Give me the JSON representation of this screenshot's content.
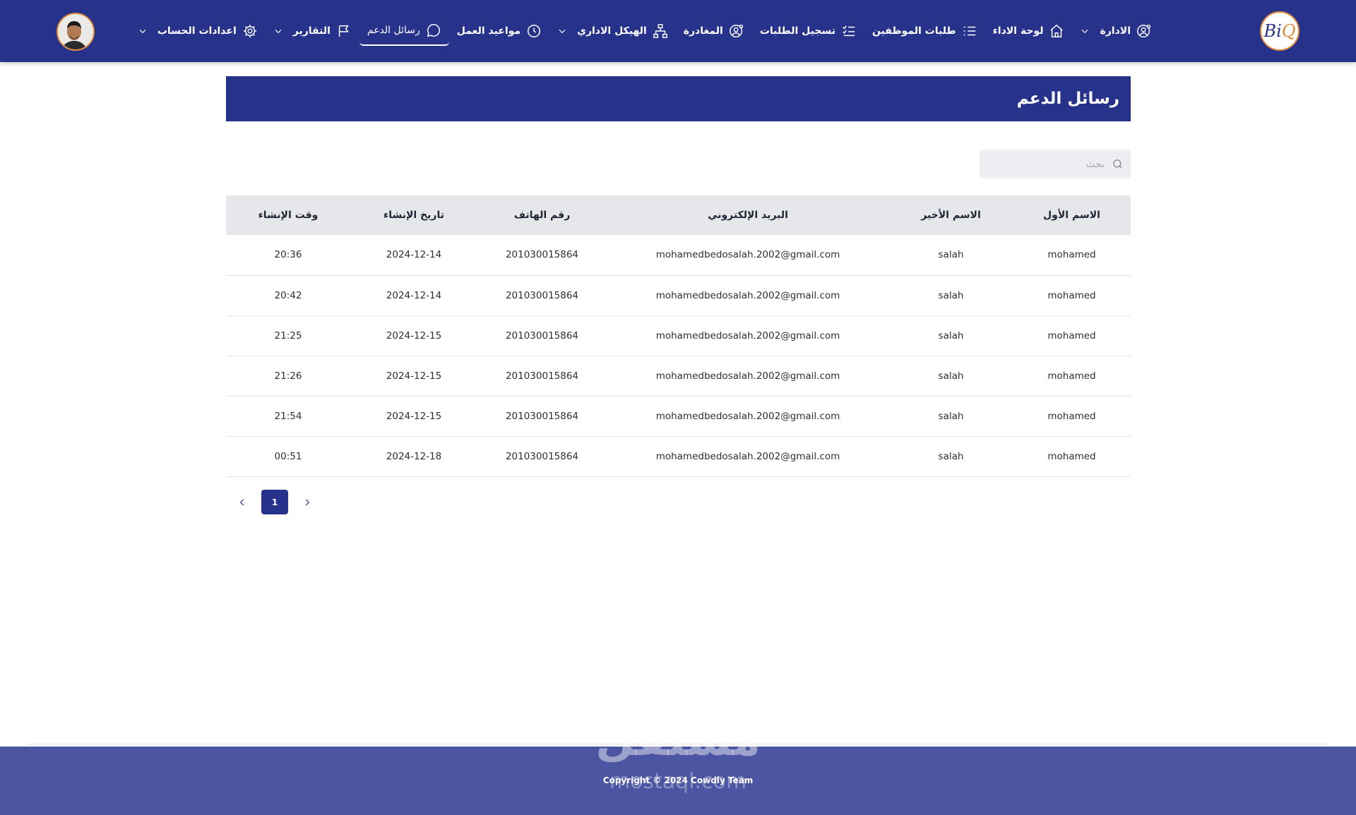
{
  "nav": {
    "logo_text": "Bi",
    "items": [
      {
        "label": "الادارة",
        "has_dropdown": true
      },
      {
        "label": "لوحة الاداء",
        "has_dropdown": false
      },
      {
        "label": "طلبات الموظفين",
        "has_dropdown": false
      },
      {
        "label": "تسجيل الطلبات",
        "has_dropdown": false
      },
      {
        "label": "المغادرة",
        "has_dropdown": false
      },
      {
        "label": "الهيكل الاداري",
        "has_dropdown": true
      },
      {
        "label": "مواعيد العمل",
        "has_dropdown": false
      },
      {
        "label": "رسائل الدعم",
        "has_dropdown": false,
        "active": true
      },
      {
        "label": "التقارير",
        "has_dropdown": true
      },
      {
        "label": "اعدادات الحساب",
        "has_dropdown": true
      }
    ]
  },
  "page": {
    "title": "رسائل الدعم"
  },
  "search": {
    "placeholder": "بحث",
    "value": ""
  },
  "table": {
    "headers": [
      "الاسم الأول",
      "الاسم الأخير",
      "البريد الإلكتروني",
      "رقم الهاتف",
      "تاريخ الإنشاء",
      "وقت الإنشاء"
    ],
    "rows": [
      [
        "mohamed",
        "salah",
        "mohamedbedosalah.2002@gmail.com",
        "201030015864",
        "2024-12-14",
        "20:36"
      ],
      [
        "mohamed",
        "salah",
        "mohamedbedosalah.2002@gmail.com",
        "201030015864",
        "2024-12-14",
        "20:42"
      ],
      [
        "mohamed",
        "salah",
        "mohamedbedosalah.2002@gmail.com",
        "201030015864",
        "2024-12-15",
        "21:25"
      ],
      [
        "mohamed",
        "salah",
        "mohamedbedosalah.2002@gmail.com",
        "201030015864",
        "2024-12-15",
        "21:26"
      ],
      [
        "mohamed",
        "salah",
        "mohamedbedosalah.2002@gmail.com",
        "201030015864",
        "2024-12-15",
        "21:54"
      ],
      [
        "mohamed",
        "salah",
        "mohamedbedosalah.2002@gmail.com",
        "201030015864",
        "2024-12-18",
        "00:51"
      ]
    ]
  },
  "pagination": {
    "current_page": "1"
  },
  "footer": {
    "copyright": "Copyright © 2024 Cowdly Team",
    "watermark": "مستقل",
    "watermark_sub": "mostaql.com"
  },
  "colors": {
    "primary": "#27328b",
    "footer": "#4b55a2",
    "accent": "#e08a3c",
    "table_header": "#e6e7eb"
  },
  "icons": {
    "nav": [
      "user-gear-icon",
      "home-icon",
      "list-icon",
      "checklist-icon",
      "user-gear-icon",
      "org-chart-icon",
      "clock-icon",
      "chat-bubble-icon",
      "flag-icon",
      "gear-icon"
    ],
    "search": "search-icon",
    "dropdown": "chevron-down-icon",
    "pagination": [
      "chevron-left-icon",
      "chevron-right-icon"
    ]
  }
}
